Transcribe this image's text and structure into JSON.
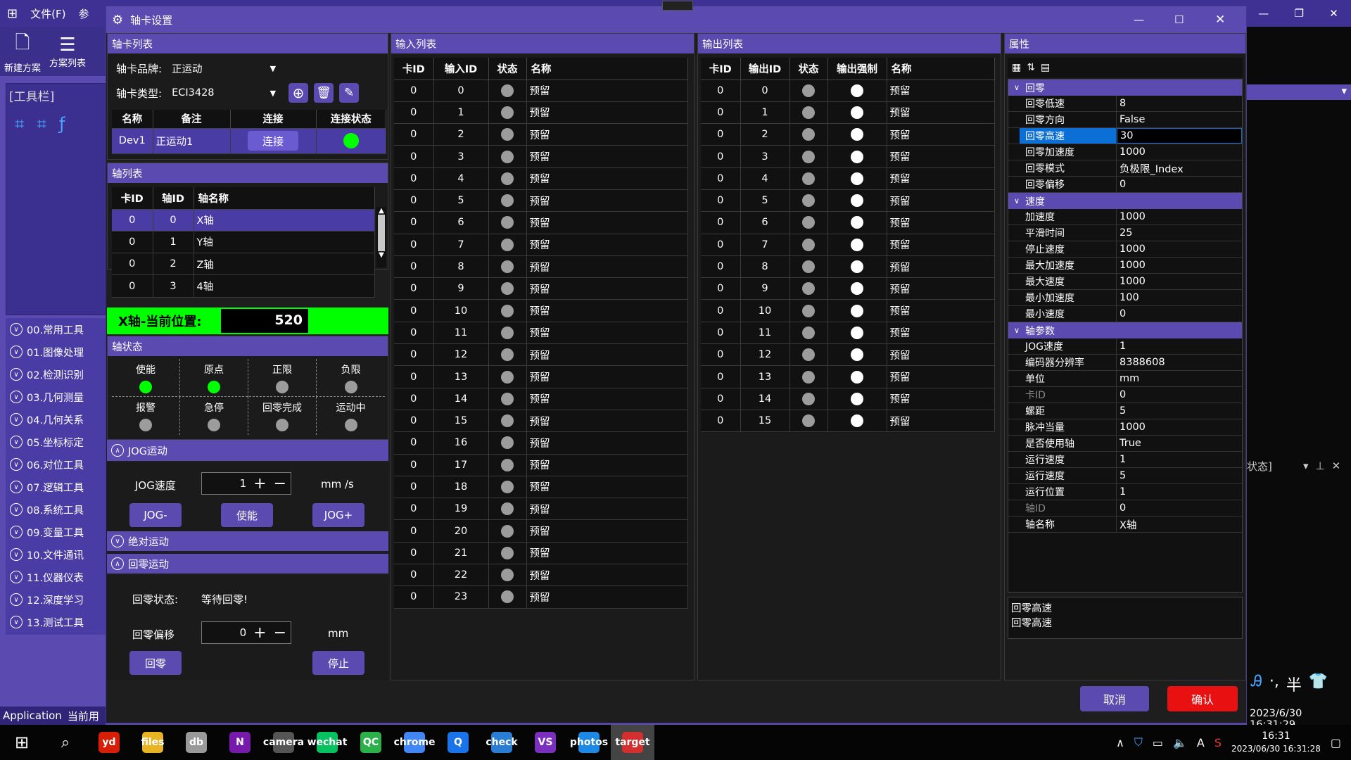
{
  "bg": {
    "menu": [
      "文件(F)",
      "参"
    ],
    "toolbar": [
      {
        "label": "新建方案",
        "icon": "new-file-icon"
      },
      {
        "label": "方案列表",
        "icon": "list-icon"
      }
    ],
    "toolbox_title": "[工具栏]",
    "tool_groups": [
      "00.常用工具",
      "01.图像处理",
      "02.检测识别",
      "03.几何测量",
      "04.几何关系",
      "05.坐标标定",
      "06.对位工具",
      "07.逻辑工具",
      "08.系统工具",
      "09.变量工具",
      "10.文件通讯",
      "11.仪器仪表",
      "12.深度学习",
      "13.测试工具"
    ],
    "status_left": "Application",
    "status_right": "当前用",
    "right_label": "状态]",
    "right_timestamp": "2023/6/30 16:31:29"
  },
  "dialog": {
    "title": "轴卡设置",
    "card_panel": {
      "title": "轴卡列表",
      "brand_label": "轴卡品牌:",
      "brand_value": "正运动",
      "type_label": "轴卡类型:",
      "type_value": "ECI3428",
      "columns": [
        "名称",
        "备注",
        "连接",
        "连接状态"
      ],
      "row": {
        "name": "Dev1",
        "note": "正运动1",
        "connect": "连接"
      }
    },
    "axis_panel": {
      "title": "轴列表",
      "columns": [
        "卡ID",
        "轴ID",
        "轴名称"
      ],
      "rows": [
        [
          "0",
          "0",
          "X轴"
        ],
        [
          "0",
          "1",
          "Y轴"
        ],
        [
          "0",
          "2",
          "Z轴"
        ],
        [
          "0",
          "3",
          "4轴"
        ]
      ]
    },
    "position": {
      "label": "X轴-当前位置:",
      "value": "520"
    },
    "axis_status": {
      "title": "轴状态",
      "row1": [
        "使能",
        "原点",
        "正限",
        "负限"
      ],
      "row2": [
        "报警",
        "急停",
        "回零完成",
        "运动中"
      ]
    },
    "jog": {
      "title": "JOG运动",
      "speed_label": "JOG速度",
      "speed_value": "1",
      "unit": "mm /s",
      "btn_minus": "JOG-",
      "btn_enable": "使能",
      "btn_plus": "JOG+"
    },
    "abs_title": "绝对运动",
    "home": {
      "title": "回零运动",
      "status_label": "回零状态:",
      "status_value": "等待回零!",
      "offset_label": "回零偏移",
      "offset_value": "0",
      "unit": "mm",
      "btn_home": "回零",
      "btn_stop": "停止"
    },
    "input_panel": {
      "title": "输入列表",
      "columns": [
        "卡ID",
        "输入ID",
        "状态",
        "名称"
      ],
      "name": "预留",
      "card": "0",
      "ids": [
        "0",
        "1",
        "2",
        "3",
        "4",
        "5",
        "6",
        "7",
        "8",
        "9",
        "10",
        "11",
        "12",
        "13",
        "14",
        "15",
        "16",
        "17",
        "18",
        "19",
        "20",
        "21",
        "22",
        "23"
      ]
    },
    "output_panel": {
      "title": "输出列表",
      "columns": [
        "卡ID",
        "输出ID",
        "状态",
        "输出强制",
        "名称"
      ],
      "name": "预留",
      "card": "0",
      "ids": [
        "0",
        "1",
        "2",
        "3",
        "4",
        "5",
        "6",
        "7",
        "8",
        "9",
        "10",
        "11",
        "12",
        "13",
        "14",
        "15"
      ]
    },
    "props": {
      "title": "属性",
      "categories": [
        {
          "name": "回零",
          "rows": [
            [
              "回零低速",
              "8"
            ],
            [
              "回零方向",
              "False"
            ],
            [
              "回零高速",
              "30"
            ],
            [
              "回零加速度",
              "1000"
            ],
            [
              "回零模式",
              "负极限_Index"
            ],
            [
              "回零偏移",
              "0"
            ]
          ]
        },
        {
          "name": "速度",
          "rows": [
            [
              "加速度",
              "1000"
            ],
            [
              "平滑时间",
              "25"
            ],
            [
              "停止速度",
              "1000"
            ],
            [
              "最大加速度",
              "1000"
            ],
            [
              "最大速度",
              "1000"
            ],
            [
              "最小加速度",
              "100"
            ],
            [
              "最小速度",
              "0"
            ]
          ]
        },
        {
          "name": "轴参数",
          "rows": [
            [
              "JOG速度",
              "1"
            ],
            [
              "编码器分辨率",
              "8388608"
            ],
            [
              "单位",
              "mm"
            ],
            [
              "卡ID",
              "0"
            ],
            [
              "螺距",
              "5"
            ],
            [
              "脉冲当量",
              "1000"
            ],
            [
              "是否使用轴",
              "True"
            ],
            [
              "运行速度",
              "1"
            ],
            [
              "运行速度",
              "5"
            ],
            [
              "运行位置",
              "1"
            ],
            [
              "轴ID",
              "0"
            ],
            [
              "轴名称",
              "X轴"
            ]
          ]
        }
      ],
      "desc_title": "回零高速",
      "desc_text": "回零高速"
    },
    "cancel": "取消",
    "confirm": "确认",
    "accent": "#5b4ab0",
    "confirm_color": "#e81010"
  },
  "taskbar": {
    "time": "16:31",
    "date": "2023/06/30 16:31:28",
    "apps": [
      "yd",
      "files",
      "db",
      "N",
      "camera",
      "wechat",
      "QC",
      "chrome",
      "Q",
      "check",
      "VS",
      "photos",
      "target"
    ]
  }
}
